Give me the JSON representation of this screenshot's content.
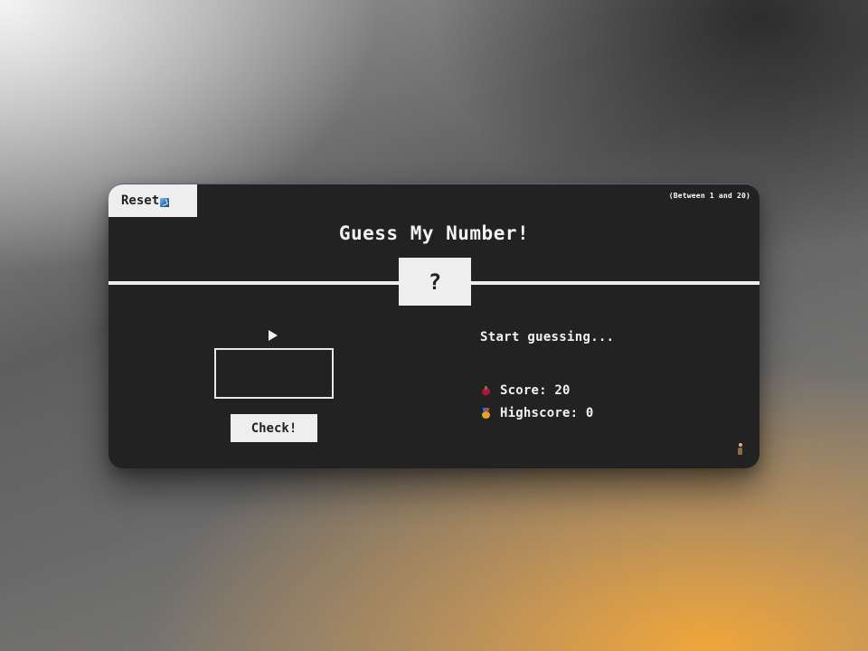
{
  "controls": {
    "reset_label": "Reset",
    "reset_icon": "refresh-icon",
    "check_label": "Check!",
    "guess_value": ""
  },
  "header": {
    "range_hint": "(Between 1 and 20)",
    "title": "Guess My Number!"
  },
  "secret": {
    "display": "?"
  },
  "status": {
    "message": "Start guessing..."
  },
  "stats": {
    "score_icon": "heart-icon",
    "score_label": "Score: ",
    "score_value": "20",
    "highscore_icon": "medal-icon",
    "highscore_label": "Highscore: ",
    "highscore_value": "0"
  },
  "colors": {
    "card_background": "#222222",
    "foreground": "#eeeeee"
  }
}
